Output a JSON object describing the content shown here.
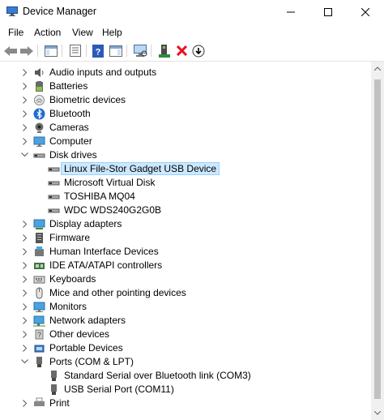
{
  "window": {
    "title": "Device Manager",
    "app_icon": "device-manager-icon"
  },
  "menu": [
    {
      "label": "File"
    },
    {
      "label": "Action"
    },
    {
      "label": "View"
    },
    {
      "label": "Help"
    }
  ],
  "toolbar": {
    "buttons": [
      "back-icon",
      "forward-icon",
      "show-hide-console-tree-icon",
      "properties-icon",
      "help-icon",
      "action-pane-icon",
      "scan-hardware-icon",
      "update-driver-icon",
      "uninstall-icon",
      "disable-device-icon"
    ]
  },
  "tree": {
    "categories": [
      {
        "label": "Audio inputs and outputs",
        "icon": "speaker-icon",
        "expanded": false
      },
      {
        "label": "Batteries",
        "icon": "battery-icon",
        "expanded": false
      },
      {
        "label": "Biometric devices",
        "icon": "fingerprint-icon",
        "expanded": false
      },
      {
        "label": "Bluetooth",
        "icon": "bluetooth-icon",
        "expanded": false
      },
      {
        "label": "Cameras",
        "icon": "camera-icon",
        "expanded": false
      },
      {
        "label": "Computer",
        "icon": "computer-icon",
        "expanded": false
      },
      {
        "label": "Disk drives",
        "icon": "disk-drive-icon",
        "expanded": true,
        "children": [
          {
            "label": "Linux File-Stor Gadget USB Device",
            "icon": "disk-drive-icon",
            "selected": true
          },
          {
            "label": "Microsoft Virtual Disk",
            "icon": "disk-drive-icon"
          },
          {
            "label": "TOSHIBA MQ04",
            "icon": "disk-drive-icon"
          },
          {
            "label": "WDC WDS240G2G0B",
            "icon": "disk-drive-icon"
          }
        ]
      },
      {
        "label": "Display adapters",
        "icon": "display-adapter-icon",
        "expanded": false
      },
      {
        "label": "Firmware",
        "icon": "firmware-icon",
        "expanded": false
      },
      {
        "label": "Human Interface Devices",
        "icon": "hid-icon",
        "expanded": false
      },
      {
        "label": "IDE ATA/ATAPI controllers",
        "icon": "ide-controller-icon",
        "expanded": false
      },
      {
        "label": "Keyboards",
        "icon": "keyboard-icon",
        "expanded": false
      },
      {
        "label": "Mice and other pointing devices",
        "icon": "mouse-icon",
        "expanded": false
      },
      {
        "label": "Monitors",
        "icon": "monitor-icon",
        "expanded": false
      },
      {
        "label": "Network adapters",
        "icon": "network-adapter-icon",
        "expanded": false
      },
      {
        "label": "Other devices",
        "icon": "other-devices-icon",
        "expanded": false
      },
      {
        "label": "Portable Devices",
        "icon": "portable-device-icon",
        "expanded": false
      },
      {
        "label": "Ports (COM & LPT)",
        "icon": "port-icon",
        "expanded": true,
        "children": [
          {
            "label": "Standard Serial over Bluetooth link (COM3)",
            "icon": "port-icon"
          },
          {
            "label": "USB Serial Port (COM11)",
            "icon": "port-icon"
          }
        ]
      },
      {
        "label": "Print",
        "icon": "printer-icon",
        "expanded": false
      }
    ]
  },
  "colors": {
    "selection_bg": "#cce8ff",
    "selection_border": "#99d1ff",
    "uninstall_red": "#e81123"
  }
}
